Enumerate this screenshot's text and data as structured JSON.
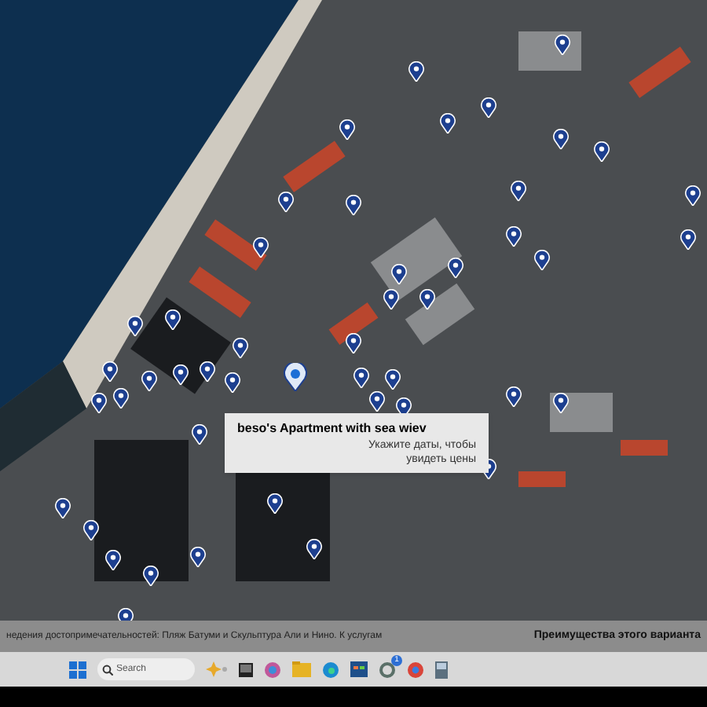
{
  "map": {
    "tooltip": {
      "title": "beso's Apartment with sea wiev",
      "subtitle": "Укажите даты, чтобы увидеть цены"
    }
  },
  "details": {
    "description": "недения достопримечательностей: Пляж Батуми и Скульптура Али и Нино. К услугам",
    "heading": "Преимущества этого варианта"
  },
  "taskbar": {
    "search": {
      "placeholder": "Search"
    },
    "whatsapp_badge": "1"
  }
}
